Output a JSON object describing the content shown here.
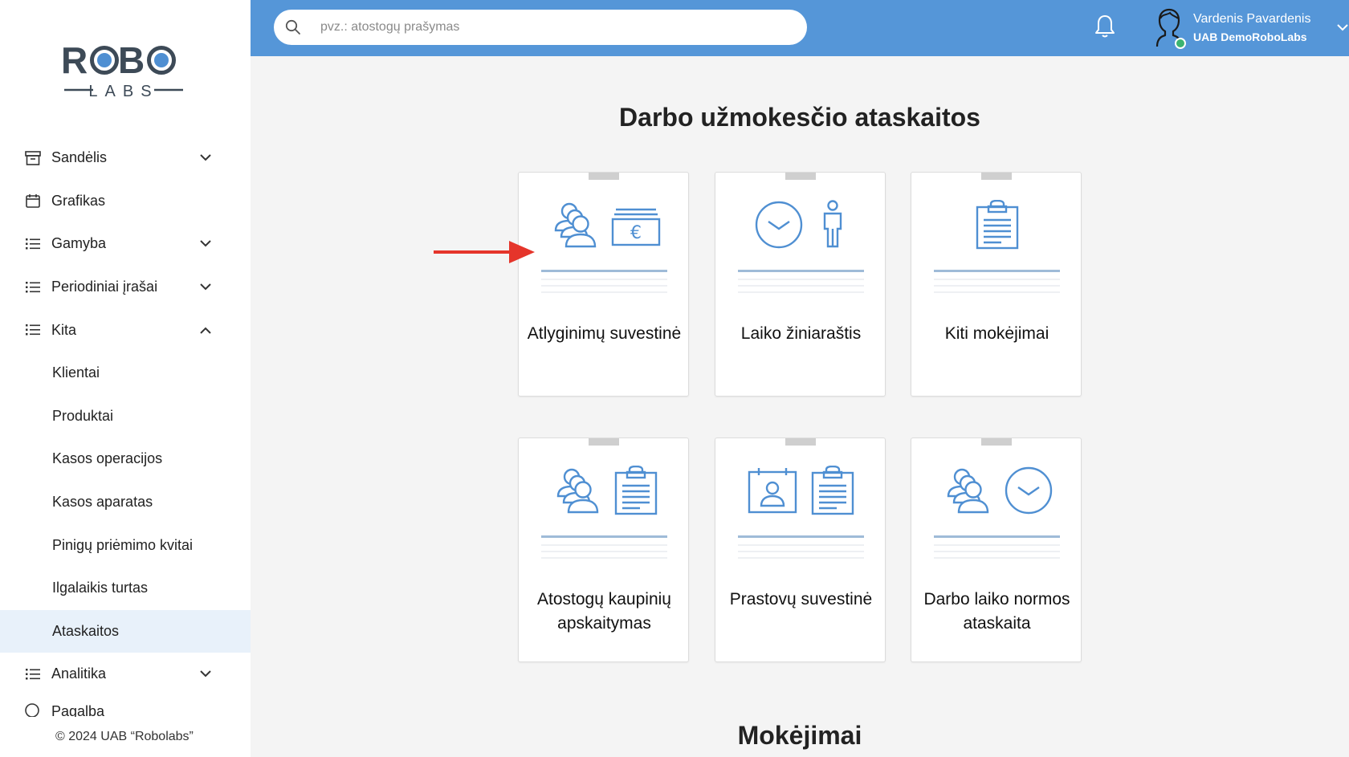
{
  "brand": {
    "logo_top": "ROBO",
    "logo_bottom": "LABS"
  },
  "colors": {
    "header": "#5596d8",
    "icon": "#4f8fd2",
    "active_bg": "#e8f1fa",
    "arrow": "#e5352b",
    "online": "#3cb371"
  },
  "sidebar": {
    "items": [
      {
        "label": "Sandėlis",
        "icon": "archive-icon",
        "expandable": true,
        "expanded": false
      },
      {
        "label": "Grafikas",
        "icon": "calendar-icon",
        "expandable": false
      },
      {
        "label": "Gamyba",
        "icon": "list-icon",
        "expandable": true,
        "expanded": false
      },
      {
        "label": "Periodiniai įrašai",
        "icon": "list-icon",
        "expandable": true,
        "expanded": false
      },
      {
        "label": "Kita",
        "icon": "list-icon",
        "expandable": true,
        "expanded": true
      },
      {
        "label": "Analitika",
        "icon": "list-icon",
        "expandable": true,
        "expanded": false
      },
      {
        "label": "Pagalba",
        "icon": "help-icon",
        "expandable": false
      }
    ],
    "kita_children": [
      {
        "label": "Klientai"
      },
      {
        "label": "Produktai"
      },
      {
        "label": "Kasos operacijos"
      },
      {
        "label": "Kasos aparatas"
      },
      {
        "label": "Pinigų priėmimo kvitai"
      },
      {
        "label": "Ilgalaikis turtas"
      },
      {
        "label": "Ataskaitos",
        "active": true
      }
    ],
    "footer": "© 2024 UAB “Robolabs”"
  },
  "header": {
    "search_placeholder": "pvz.: atostogų prašymas",
    "search_value": "",
    "user_name": "Vardenis Pavardenis",
    "user_company": "UAB DemoRoboLabs"
  },
  "main": {
    "title": "Darbo užmokesčio ataskaitos",
    "cards": [
      {
        "label": "Atlyginimų suvestinė",
        "icons": [
          "people-icon",
          "euro-cash-icon"
        ]
      },
      {
        "label": "Laiko žiniaraštis",
        "icons": [
          "clock-icon",
          "person-icon"
        ]
      },
      {
        "label": "Kiti mokėjimai",
        "icons": [
          "clipboard-icon"
        ]
      },
      {
        "label": "Atostogų kaupinių apskaitymas",
        "icons": [
          "people-icon",
          "clipboard-icon"
        ]
      },
      {
        "label": "Prastovų suvestinė",
        "icons": [
          "id-calendar-icon",
          "clipboard-icon"
        ]
      },
      {
        "label": "Darbo laiko normos ataskaita",
        "icons": [
          "people-icon",
          "clock-icon"
        ]
      }
    ],
    "next_section_title": "Mokėjimai"
  }
}
